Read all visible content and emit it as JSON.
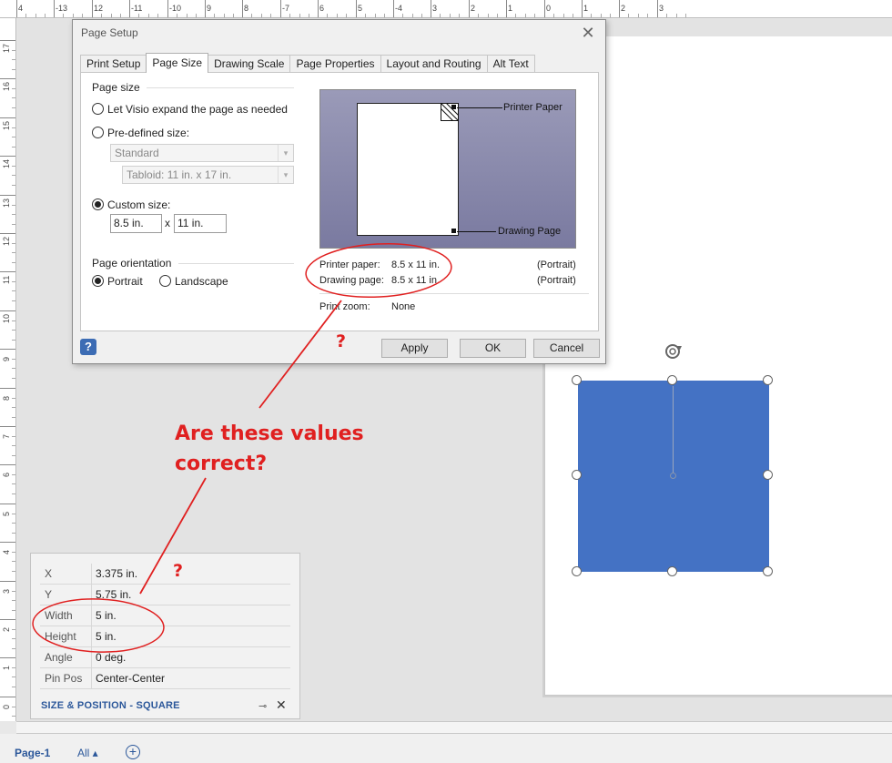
{
  "ruler": {
    "top_labels": [
      "4",
      "-13",
      "12",
      "-11",
      "-10",
      "9",
      "8",
      "-7",
      "6",
      "5",
      "-4",
      "3",
      "2",
      "1",
      "0",
      "1",
      "2",
      "3"
    ],
    "left_labels": [
      "17",
      "16",
      "15",
      "14",
      "13",
      "12",
      "11",
      "10",
      "9",
      "8",
      "7",
      "6",
      "5",
      "4",
      "3",
      "2",
      "1",
      "0"
    ]
  },
  "dialog": {
    "title": "Page Setup",
    "close_glyph": "✕",
    "tabs": [
      {
        "label": "Print Setup",
        "active": false
      },
      {
        "label": "Page Size",
        "active": true
      },
      {
        "label": "Drawing Scale",
        "active": false
      },
      {
        "label": "Page Properties",
        "active": false
      },
      {
        "label": "Layout and Routing",
        "active": false
      },
      {
        "label": "Alt Text",
        "active": false
      }
    ],
    "page_size": {
      "group_title": "Page size",
      "option_expand": "Let Visio expand the page as needed",
      "option_predefined": "Pre-defined size:",
      "predefined_type": "Standard",
      "predefined_size": "Tabloid:  11 in. x 17 in.",
      "option_custom": "Custom size:",
      "custom_width": "8.5 in.",
      "custom_separator": "x",
      "custom_height": "11 in.",
      "selected": "custom"
    },
    "orientation": {
      "group_title": "Page orientation",
      "portrait": "Portrait",
      "landscape": "Landscape",
      "selected": "portrait"
    },
    "preview": {
      "printer_paper_label": "Printer Paper",
      "drawing_page_label": "Drawing Page"
    },
    "info": {
      "printer_paper_key": "Printer paper:",
      "printer_paper_val": "8.5 x 11 in.",
      "printer_paper_orient": "(Portrait)",
      "drawing_page_key": "Drawing page:",
      "drawing_page_val": "8.5 x 11 in.",
      "drawing_page_orient": "(Portrait)",
      "print_zoom_key": "Print zoom:",
      "print_zoom_val": "None"
    },
    "buttons": {
      "help": "?",
      "apply": "Apply",
      "ok": "OK",
      "cancel": "Cancel"
    }
  },
  "size_position": {
    "rows": [
      {
        "key": "X",
        "value": "3.375 in."
      },
      {
        "key": "Y",
        "value": "5.75 in."
      },
      {
        "key": "Width",
        "value": "5 in."
      },
      {
        "key": "Height",
        "value": "5 in."
      },
      {
        "key": "Angle",
        "value": "0 deg."
      },
      {
        "key": "Pin Pos",
        "value": "Center-Center"
      }
    ],
    "title": "SIZE & POSITION - SQUARE",
    "pin_glyph": "⊸",
    "close_glyph": "✕"
  },
  "bottom": {
    "page_tab": "Page-1",
    "all_tab": "All ▴",
    "add_glyph": "+"
  },
  "annotations": {
    "question": "Are these values correct?",
    "qmark_1": "?",
    "qmark_2": "?",
    "color": "#e02020"
  },
  "colors": {
    "shape_fill": "#4472c4",
    "accent": "#2b579a"
  }
}
